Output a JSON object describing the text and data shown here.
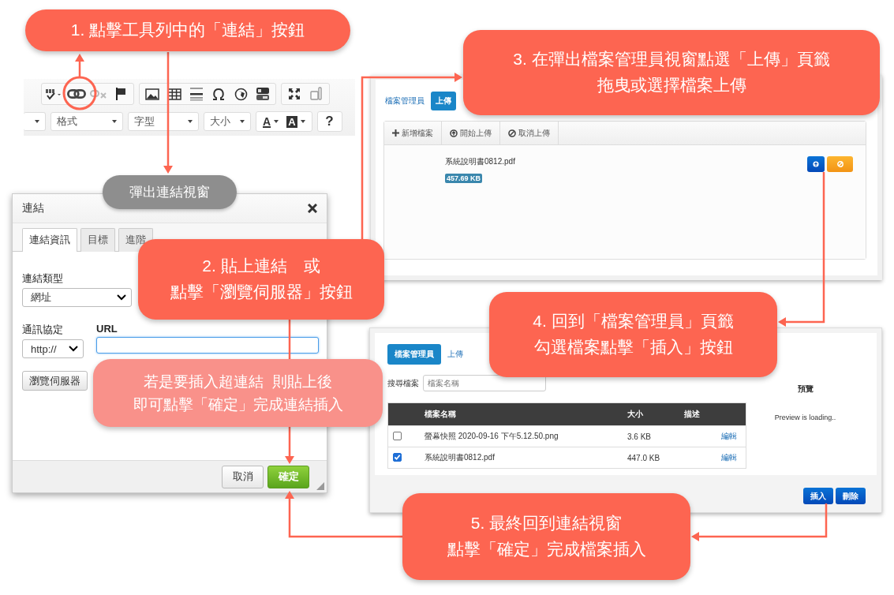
{
  "callouts": [
    {
      "kind": "main",
      "lines": [
        "1. 點擊工具列中的「連結」按鈕"
      ]
    },
    {
      "kind": "main",
      "lines": [
        "2. 貼上連結　或",
        "點擊「瀏覽伺服器」按鈕"
      ]
    },
    {
      "kind": "tip",
      "lines": [
        "若是要插入超連結  則貼上後",
        "即可點擊「確定」完成連結插入"
      ]
    },
    {
      "kind": "main",
      "lines": [
        "3. 在彈出檔案管理員視窗點選「上傳」頁籤",
        "拖曳或選擇檔案上傳"
      ]
    },
    {
      "kind": "main",
      "lines": [
        "4. 回到「檔案管理員」頁籤",
        "勾選檔案點擊「插入」按鈕"
      ]
    },
    {
      "kind": "main",
      "lines": [
        "5. 最終回到連結視窗",
        "點擊「確定」完成檔案插入"
      ]
    }
  ],
  "popup_label": "彈出連結視窗",
  "toolbar": {
    "dropdowns": [
      "格式",
      "字型",
      "大小"
    ],
    "text_color_button": "A",
    "bg_color_button": "A",
    "help_button": "?"
  },
  "link_dialog": {
    "title": "連結",
    "tabs": [
      {
        "label": "連結資訊",
        "selected": true
      },
      {
        "label": "目標",
        "selected": false
      },
      {
        "label": "進階",
        "selected": false
      }
    ],
    "link_type": {
      "label": "連結類型",
      "value": "網址"
    },
    "protocol": {
      "label": "通訊協定",
      "value": "http://"
    },
    "url": {
      "label": "URL",
      "focused": true
    },
    "browse_button": "瀏覽伺服器",
    "buttons": [
      {
        "label": "取消",
        "kind": "default"
      },
      {
        "label": "確定",
        "kind": "primary"
      }
    ]
  },
  "upload_panel": {
    "tabs": [
      {
        "label": "檔案管理員",
        "selected": false
      },
      {
        "label": "上傳",
        "selected": true
      }
    ],
    "actions": [
      {
        "label": "新增檔案",
        "kind": "plus"
      },
      {
        "label": "開始上傳",
        "kind": "upload"
      },
      {
        "label": "取消上傳",
        "kind": "cancel"
      }
    ],
    "file": {
      "name": "系統說明書0812.pdf",
      "size": "457.69 KB"
    }
  },
  "file_manager": {
    "tabs": [
      {
        "label": "檔案管理員",
        "selected": true
      },
      {
        "label": "上傳",
        "selected": false
      }
    ],
    "search": {
      "label": "搜尋檔案",
      "placeholder": "檔案名稱"
    },
    "preview": {
      "title": "預覽",
      "status": "Preview is loading.."
    },
    "table": {
      "columns": [
        "檔案名稱",
        "大小",
        "描述"
      ],
      "rows": [
        {
          "checked": false,
          "name": "螢幕快照 2020-09-16 下午5.12.50.png",
          "size": "3.6 KB",
          "action": "編輯"
        },
        {
          "checked": true,
          "name": "系統說明書0812.pdf",
          "size": "447.0 KB",
          "action": "編輯"
        }
      ]
    },
    "buttons": [
      "插入",
      "刪除"
    ]
  }
}
